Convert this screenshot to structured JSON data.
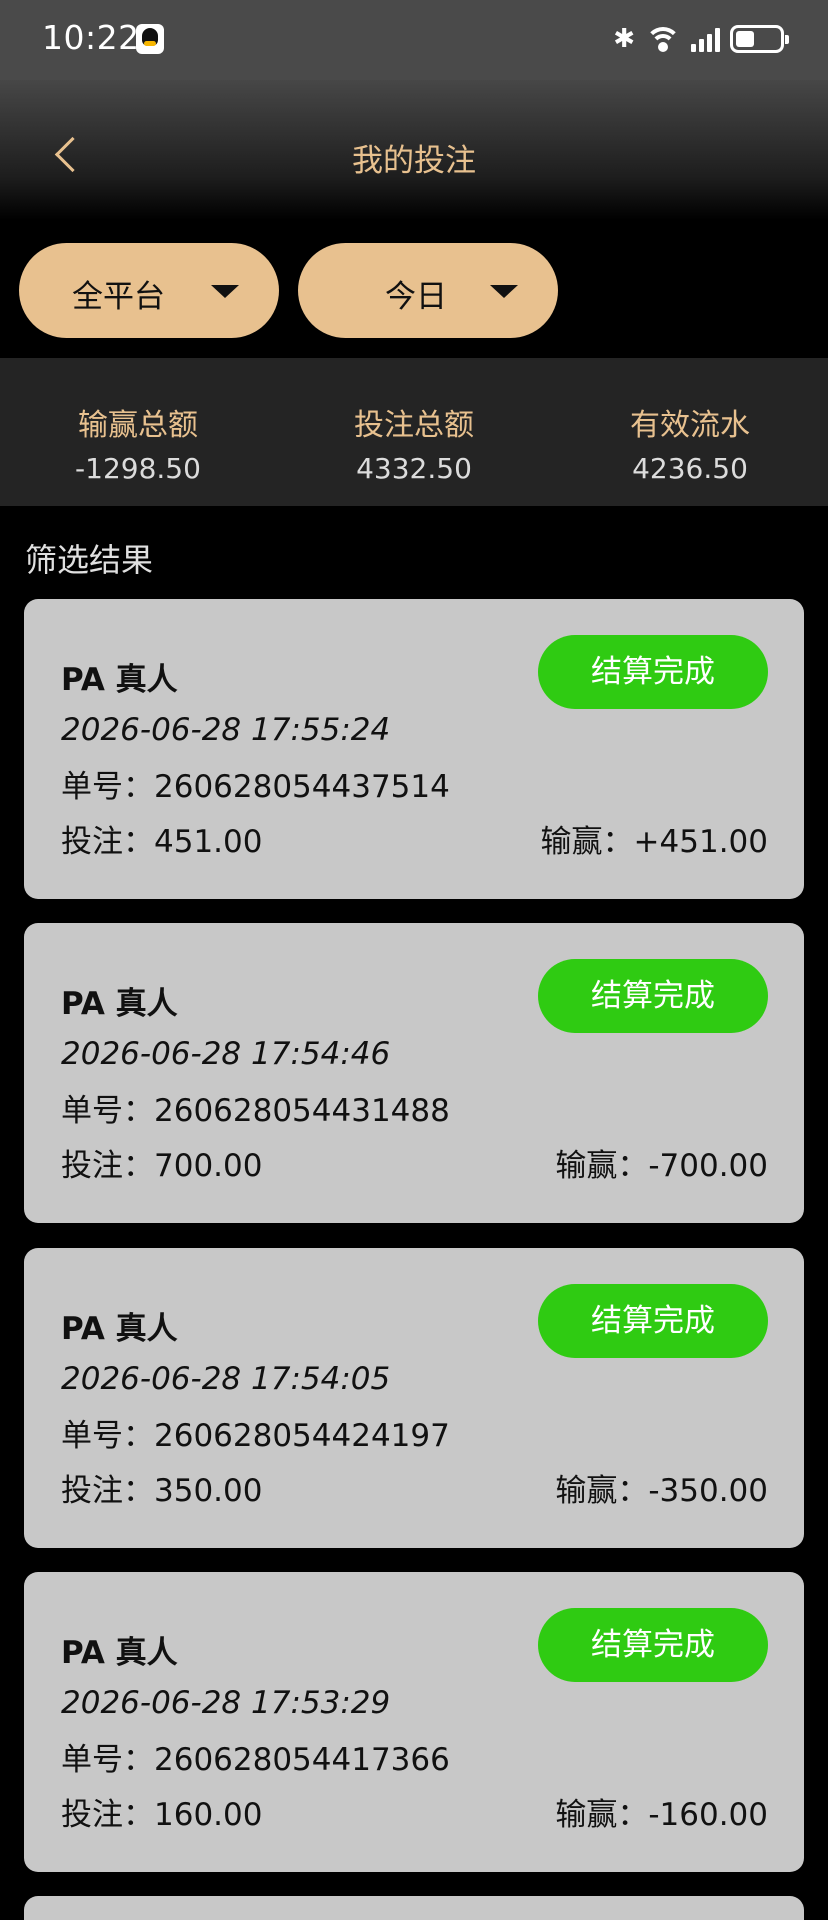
{
  "status_bar": {
    "time": "10:22"
  },
  "header": {
    "title": "我的投注"
  },
  "filters": {
    "platform": "全平台",
    "period": "今日"
  },
  "summary": [
    {
      "label": "输赢总额",
      "value": "-1298.50"
    },
    {
      "label": "投注总额",
      "value": "4332.50"
    },
    {
      "label": "有效流水",
      "value": "4236.50"
    }
  ],
  "section_title": "筛选结果",
  "records": [
    {
      "platform": "PA 真人",
      "status": "结算完成",
      "time": "2026-06-28 17:55:24",
      "order": "单号：260628054437514",
      "bet": "投注：451.00",
      "pnl": "输赢：+451.00"
    },
    {
      "platform": "PA 真人",
      "status": "结算完成",
      "time": "2026-06-28 17:54:46",
      "order": "单号：260628054431488",
      "bet": "投注：700.00",
      "pnl": "输赢：-700.00"
    },
    {
      "platform": "PA 真人",
      "status": "结算完成",
      "time": "2026-06-28 17:54:05",
      "order": "单号：260628054424197",
      "bet": "投注：350.00",
      "pnl": "输赢：-350.00"
    },
    {
      "platform": "PA 真人",
      "status": "结算完成",
      "time": "2026-06-28 17:53:29",
      "order": "单号：260628054417366",
      "bet": "投注：160.00",
      "pnl": "输赢：-160.00"
    }
  ]
}
